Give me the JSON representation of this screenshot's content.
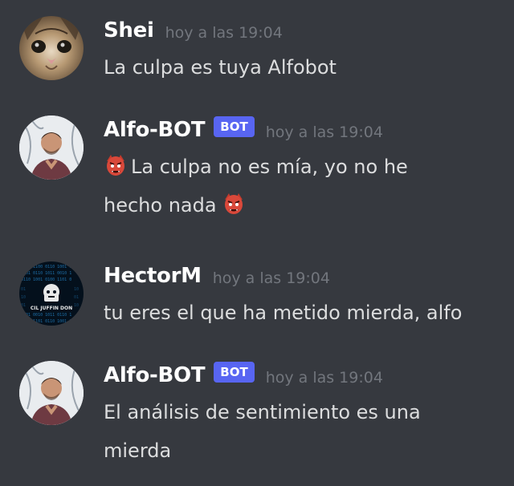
{
  "messages": [
    {
      "author": "Shei",
      "bot": false,
      "bot_label": "",
      "timestamp": "hoy a las 19:04",
      "avatar_icon": "cat-avatar",
      "text": "La culpa es tuya Alfobot"
    },
    {
      "author": "Alfo-BOT",
      "bot": true,
      "bot_label": "BOT",
      "timestamp": "hoy a las 19:04",
      "avatar_icon": "man-avatar",
      "text_parts": [
        "La culpa no es mía, yo no he",
        "hecho nada"
      ],
      "emoji": "japanese-goblin"
    },
    {
      "author": "HectorM",
      "bot": false,
      "bot_label": "",
      "timestamp": "hoy a las 19:04",
      "avatar_icon": "matrix-avatar",
      "avatar_caption": "CIL JUFFIN DON",
      "text": "tu eres el que ha metido mierda, alfo"
    },
    {
      "author": "Alfo-BOT",
      "bot": true,
      "bot_label": "BOT",
      "timestamp": "hoy a las 19:04",
      "avatar_icon": "man-avatar",
      "text_parts": [
        "El análisis de sentimiento es una",
        "mierda"
      ]
    }
  ],
  "colors": {
    "background": "#36393f",
    "username": "#ffffff",
    "message_text": "#dcddde",
    "timestamp": "#72767d",
    "bot_tag": "#5865f2"
  }
}
